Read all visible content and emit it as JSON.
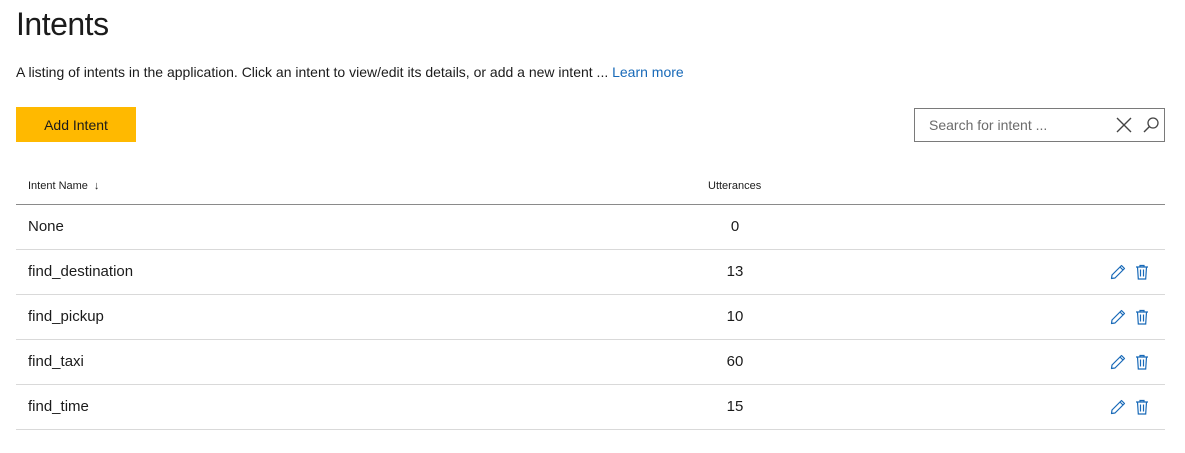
{
  "page": {
    "title": "Intents",
    "description": "A listing of intents in the application. Click an intent to view/edit its details, or add a new intent ... ",
    "learn_more": "Learn more"
  },
  "toolbar": {
    "add_label": "Add Intent",
    "search_placeholder": "Search for intent ..."
  },
  "table": {
    "columns": {
      "name": "Intent Name",
      "name_sort_arrow": "↓",
      "utterances": "Utterances"
    },
    "rows": [
      {
        "name": "None",
        "utterances": "0",
        "actions": false
      },
      {
        "name": "find_destination",
        "utterances": "13",
        "actions": true
      },
      {
        "name": "find_pickup",
        "utterances": "10",
        "actions": true
      },
      {
        "name": "find_taxi",
        "utterances": "60",
        "actions": true
      },
      {
        "name": "find_time",
        "utterances": "15",
        "actions": true
      }
    ]
  },
  "icons": {
    "search": "search-icon",
    "clear": "close-icon",
    "edit": "pencil-icon",
    "delete": "trash-icon"
  },
  "colors": {
    "accent_button": "#ffb900",
    "link": "#1769b8",
    "action_icon": "#1769b8"
  }
}
